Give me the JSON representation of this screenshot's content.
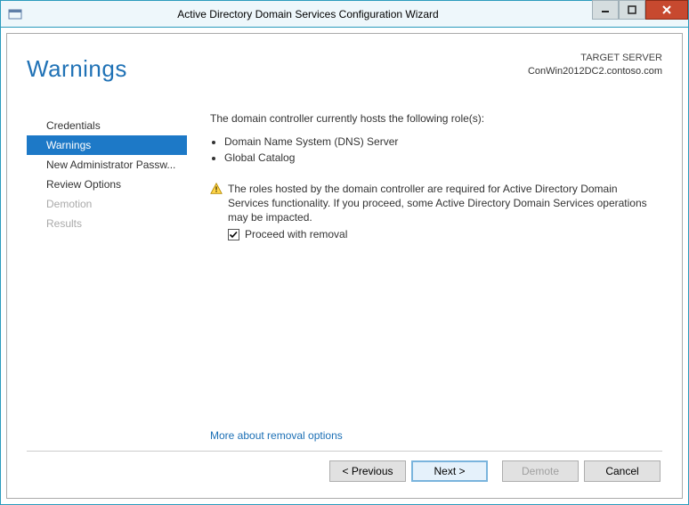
{
  "window": {
    "title": "Active Directory Domain Services Configuration Wizard"
  },
  "header": {
    "heading": "Warnings",
    "target_label": "TARGET SERVER",
    "target_server": "ConWin2012DC2.contoso.com"
  },
  "nav": {
    "items": [
      {
        "label": "Credentials",
        "state": "normal"
      },
      {
        "label": "Warnings",
        "state": "selected"
      },
      {
        "label": "New Administrator Passw...",
        "state": "normal"
      },
      {
        "label": "Review Options",
        "state": "normal"
      },
      {
        "label": "Demotion",
        "state": "disabled"
      },
      {
        "label": "Results",
        "state": "disabled"
      }
    ]
  },
  "content": {
    "intro": "The domain controller currently hosts the following role(s):",
    "roles": [
      "Domain Name System (DNS) Server",
      "Global Catalog"
    ],
    "warning": "The roles hosted by the domain controller are required for Active Directory Domain Services functionality. If you proceed, some Active Directory Domain Services operations may be impacted.",
    "checkbox_label": "Proceed with removal",
    "checkbox_checked": true,
    "more_link": "More about removal options"
  },
  "buttons": {
    "previous": "< Previous",
    "next": "Next >",
    "demote": "Demote",
    "cancel": "Cancel"
  }
}
